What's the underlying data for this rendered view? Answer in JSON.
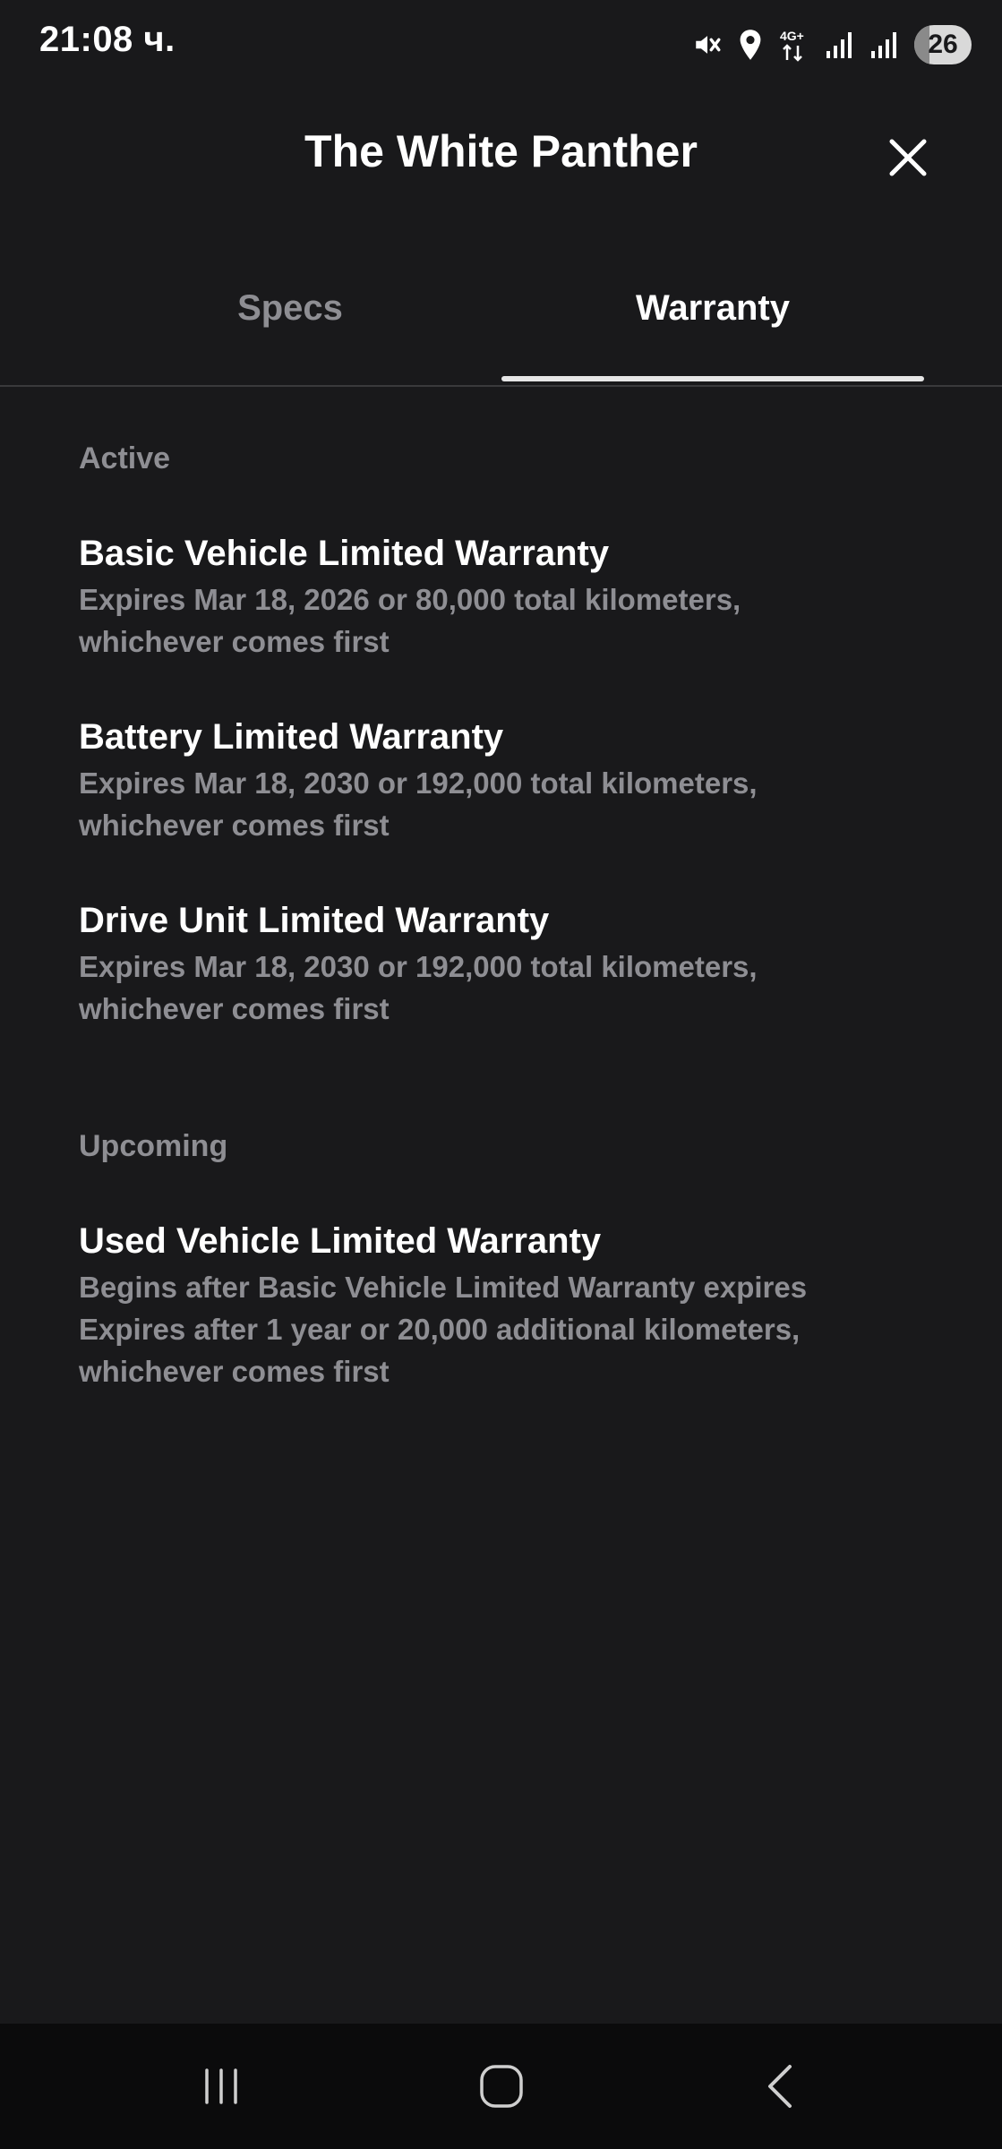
{
  "status_bar": {
    "time": "21:08 ч.",
    "network": "4G+",
    "battery_level": 26,
    "battery_text": "26",
    "icons": [
      "mute-icon",
      "location-icon",
      "network-4g-icon",
      "signal-icon",
      "signal-icon",
      "battery-icon"
    ]
  },
  "header": {
    "title": "The White Panther",
    "close_icon": "close-icon"
  },
  "tabs": [
    {
      "label": "Specs",
      "active": false
    },
    {
      "label": "Warranty",
      "active": true
    }
  ],
  "sections": {
    "active": {
      "label": "Active",
      "items": [
        {
          "title": "Basic Vehicle Limited Warranty",
          "description": "Expires Mar 18, 2026 or 80,000 total kilometers,\nwhichever comes first"
        },
        {
          "title": "Battery Limited Warranty",
          "description": "Expires Mar 18, 2030 or 192,000 total kilometers,\nwhichever comes first"
        },
        {
          "title": "Drive Unit Limited Warranty",
          "description": "Expires Mar 18, 2030 or 192,000 total kilometers,\nwhichever comes first"
        }
      ]
    },
    "upcoming": {
      "label": "Upcoming",
      "items": [
        {
          "title": "Used Vehicle Limited Warranty",
          "description": "Begins after Basic Vehicle Limited Warranty expires\nExpires after 1 year or 20,000 additional kilometers,\nwhichever comes first"
        }
      ]
    }
  },
  "nav_bar": {
    "icons": [
      "recent-apps-icon",
      "home-icon",
      "back-icon"
    ]
  },
  "colors": {
    "background": "#19191b",
    "primary_text": "#ffffff",
    "secondary_text": "#8e8e93",
    "nav_background": "#0b0b0c"
  }
}
